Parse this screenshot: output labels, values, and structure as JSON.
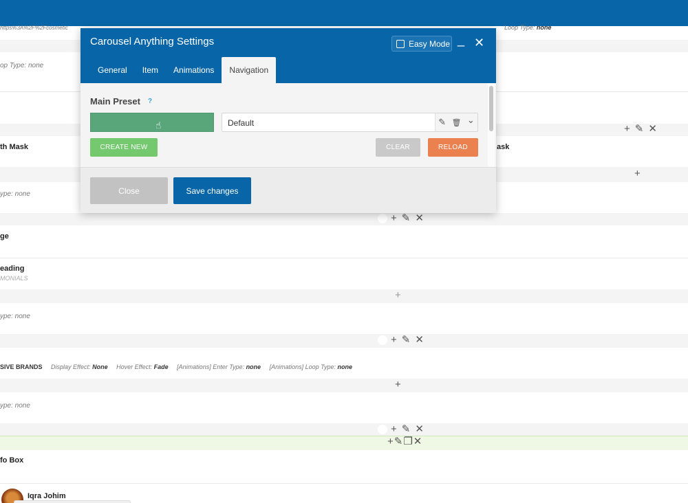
{
  "background": {
    "url_fragment": "https%3A%2F%2Fcosmetic",
    "url_loop_label": "Loop Type:",
    "url_loop_value": "none",
    "row1_label": "op Type: none",
    "row2_title": "th Mask",
    "row2_right_title": "ask",
    "row3_label": "ype: none",
    "row4_title": "ge",
    "row5_title": "eading",
    "row5_sub": "MONIALS",
    "row6_label": "ype: none",
    "brands": {
      "title": "SIVE BRANDS",
      "display_label": "Display Effect:",
      "display_value": "None",
      "hover_label": "Hover Effect:",
      "hover_value": "Fade",
      "enter_label": "[Animations] Enter Type:",
      "enter_value": "none",
      "loop_label": "[Animations] Loop Type:",
      "loop_value": "none"
    },
    "row8_label": "ype: none",
    "infobox_title": "fo Box",
    "user_name": "Iqra Johim"
  },
  "modal": {
    "title": "Carousel Anything Settings",
    "easy_mode_label": "Easy Mode",
    "minimize_glyph": "_",
    "close_glyph": "✕",
    "tabs": [
      {
        "label": "General",
        "active": false
      },
      {
        "label": "Item",
        "active": false
      },
      {
        "label": "Animations",
        "active": false
      },
      {
        "label": "Navigation",
        "active": true
      }
    ],
    "main_preset_label": "Main Preset",
    "help_glyph": "?",
    "preset_value": "Default",
    "create_new_label": "CREATE NEW",
    "clear_label": "CLEAR",
    "reload_label": "RELOAD",
    "close_label": "Close",
    "save_label": "Save changes"
  },
  "icons": {
    "plus": "+",
    "pencil": "✎",
    "cross": "✕",
    "trash": "🗑",
    "chevron": "⌄",
    "copy": "❐",
    "hand": "☝"
  },
  "colors": {
    "brand_blue": "#0866a8",
    "green_button": "#5aa67b",
    "create_green": "#74c96f",
    "reload_orange": "#ec8150",
    "clear_grey": "#c9c9c9"
  }
}
